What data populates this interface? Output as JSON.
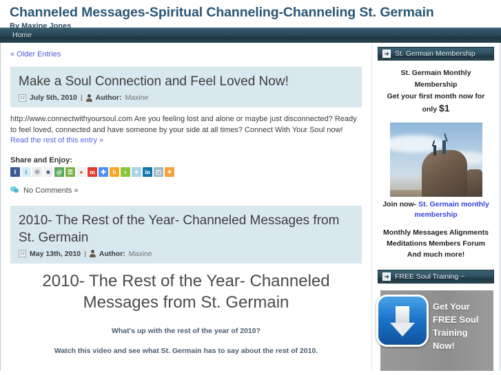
{
  "header": {
    "site_title": "Channeled Messages-Spiritual Channeling-Channeling St. Germain",
    "tagline": "By Maxine Jones"
  },
  "nav": {
    "items": [
      {
        "label": "Home"
      }
    ]
  },
  "content": {
    "older_entries": "« Older Entries",
    "posts": [
      {
        "title": "Make a Soul Connection and Feel Loved Now!",
        "date": "July 5th, 2010",
        "separator": "|",
        "author_label": "Author:",
        "author": "Maxine",
        "calendar_day": "12",
        "body_text": "http://www.connectwithyoursoul.com Are you feeling lost and alone or maybe just disconnected? Ready to feel loved, connected and have someone by your side at all times? Connect With Your Soul now! ",
        "read_more": "Read the rest of this entry »",
        "share_label": "Share and Enjoy:",
        "comments": "No Comments »"
      },
      {
        "title": "2010- The Rest of the Year- Channeled Messages from St. Germain",
        "date": "May 13th, 2010",
        "separator": "|",
        "author_label": "Author:",
        "author": "Maxine",
        "calendar_day": "12"
      }
    ],
    "article": {
      "title": "2010- The Rest of the Year- Channeled Messages from St. Germain",
      "line1": "What's up with the rest of the year of 2010?",
      "line2": "Watch this video and see what St. Germain has to say about the rest of 2010."
    },
    "share_icons": [
      {
        "name": "facebook-icon",
        "glyph": "f",
        "color": "#3b5998",
        "fg": "#ffffff"
      },
      {
        "name": "twitter-icon",
        "glyph": "t",
        "color": "#d9eef5",
        "fg": "#2a8fb5"
      },
      {
        "name": "friendfeed-icon",
        "glyph": "☸",
        "color": "#e8eaec",
        "fg": "#9aa3ab"
      },
      {
        "name": "delicious-icon",
        "glyph": "■",
        "color": "#f0f0f0",
        "fg": "#3b5998"
      },
      {
        "name": "stumbleupon-icon",
        "glyph": "@",
        "color": "#5aa85c",
        "fg": "#ffffff"
      },
      {
        "name": "technorati-icon",
        "glyph": "☰",
        "color": "#7cb342",
        "fg": "#ffffff"
      },
      {
        "name": "reddit-icon",
        "glyph": "●",
        "color": "#f2f2f2",
        "fg": "#c46a4f"
      },
      {
        "name": "mixx-icon",
        "glyph": "m",
        "color": "#e23b2e",
        "fg": "#ffffff"
      },
      {
        "name": "google-icon",
        "glyph": "✚",
        "color": "#4e8ef7",
        "fg": "#ffffff"
      },
      {
        "name": "blogger-icon",
        "glyph": "b",
        "color": "#f5a623",
        "fg": "#ffffff"
      },
      {
        "name": "posterous-icon",
        "glyph": "◗",
        "color": "#8cc63f",
        "fg": "#ffffff"
      },
      {
        "name": "netvibes-icon",
        "glyph": "✦",
        "color": "#a9d3e8",
        "fg": "#ffffff"
      },
      {
        "name": "linkedin-icon",
        "glyph": "in",
        "color": "#0e76a8",
        "fg": "#ffffff"
      },
      {
        "name": "windows-live-icon",
        "glyph": "◰",
        "color": "#9fb6c4",
        "fg": "#ffffff"
      },
      {
        "name": "share-more-icon",
        "glyph": "✦",
        "color": "#f4a23c",
        "fg": "#ffffff"
      }
    ]
  },
  "sidebar": {
    "widgets": [
      {
        "title": "St. Germain Membership",
        "arrow": "➜",
        "heading1": "St. Germain Monthly Membership",
        "heading2_pre": "Get your first month now for only ",
        "heading2_price": "$1",
        "join_prefix": "Join now- ",
        "join_link": "St. Germain monthly membership",
        "features": [
          "Monthly Messages Alignments",
          "Meditations Members Forum",
          "And much more!"
        ]
      },
      {
        "title": "FREE Soul Training ~",
        "arrow": "➜",
        "promo_text": "Get Your FREE Soul Training Now!"
      }
    ]
  },
  "colors": {
    "title_blue": "#2b5777",
    "nav_dark": "#1d3743",
    "post_head_bg": "#d9e8ee",
    "link_blue": "#5566e0",
    "accent_blue": "#1a73c8"
  }
}
